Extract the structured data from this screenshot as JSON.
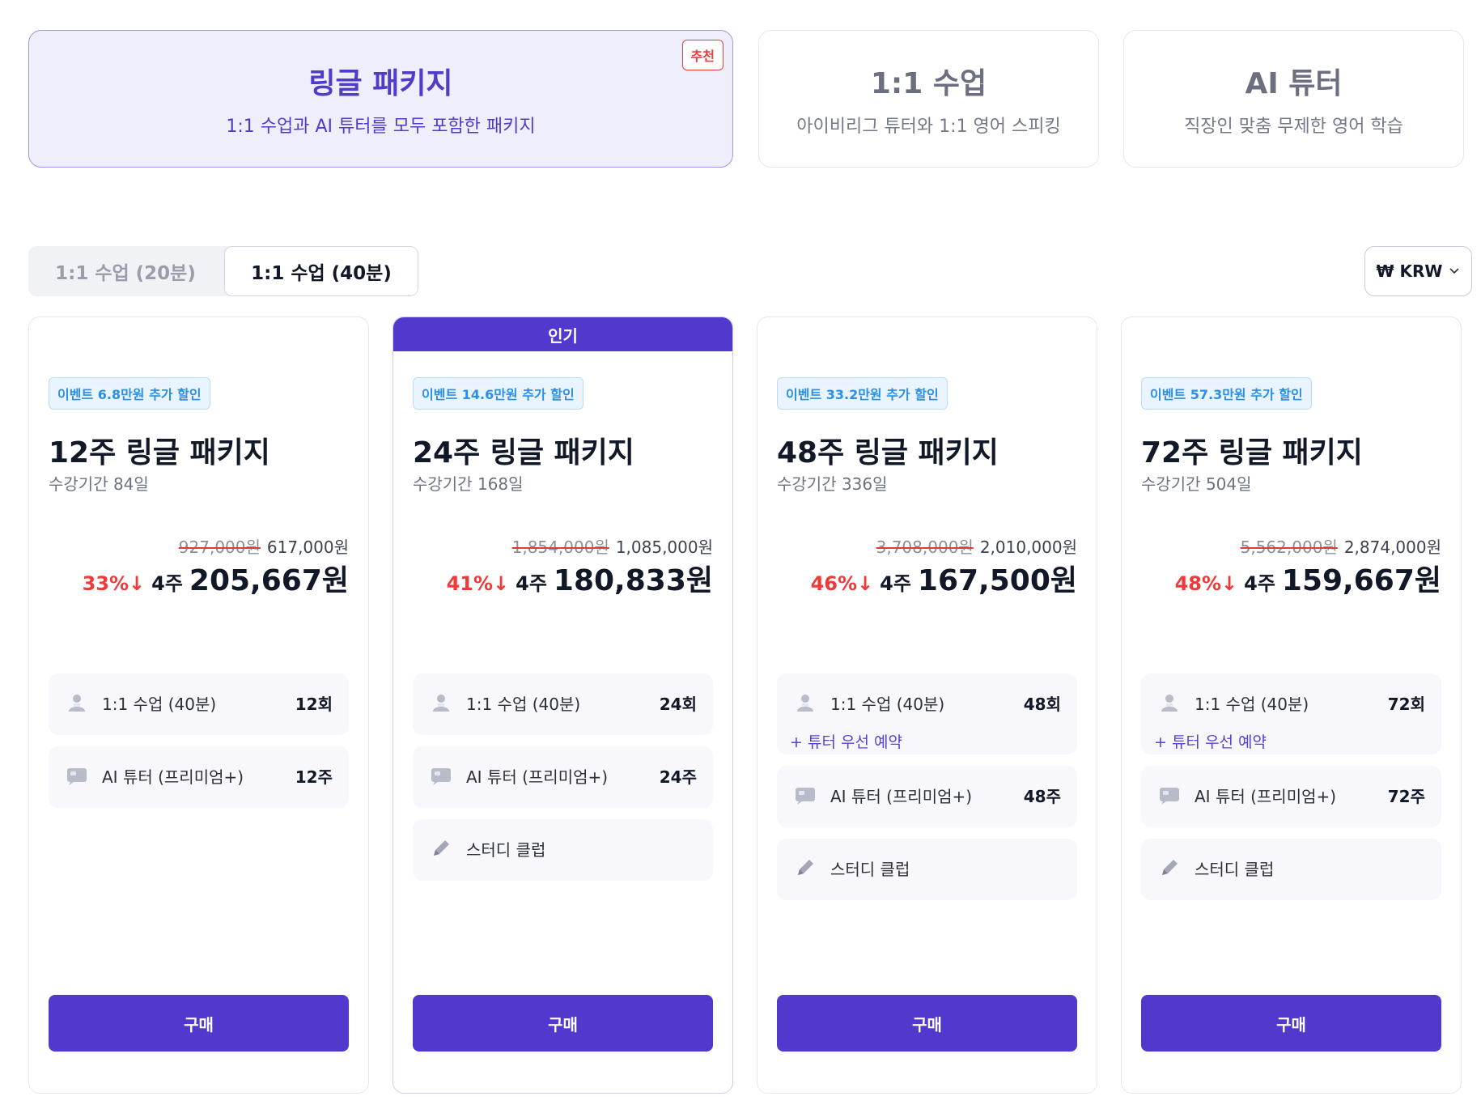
{
  "product_tabs": [
    {
      "title": "링글 패키지",
      "subtitle": "1:1 수업과 AI 튜터를 모두 포함한 패키지",
      "badge": "추천",
      "active": true
    },
    {
      "title": "1:1 수업",
      "subtitle": "아이비리그 튜터와 1:1 영어 스피킹"
    },
    {
      "title": "AI 튜터",
      "subtitle": "직장인 맞춤 무제한 영어 학습"
    }
  ],
  "duration_toggle": {
    "options": [
      "1:1 수업 (20분)",
      "1:1 수업 (40분)"
    ],
    "selected": "1:1 수업 (40분)"
  },
  "currency": {
    "label": "₩ KRW",
    "symbol_icon": "chevron-down-icon"
  },
  "colors": {
    "accent": "#5238cc",
    "discount": "#ef3a3a",
    "event": "#2b8fe6"
  },
  "plans": [
    {
      "event": "이벤트 6.8만원 추가 할인",
      "title": "12주 링글 패키지",
      "period": "수강기간 84일",
      "original_price": "927,000원",
      "price": "617,000원",
      "discount": "33%↓",
      "per_label": "4주",
      "per_price": "205,667원",
      "features": [
        {
          "label": "1:1 수업 (40분)",
          "value": "12회",
          "icon": "tutor-icon"
        },
        {
          "label": "AI 튜터 (프리미엄+)",
          "value": "12주",
          "icon": "chat-icon"
        }
      ],
      "buy": "구매"
    },
    {
      "popular": "인기",
      "event": "이벤트 14.6만원 추가 할인",
      "title": "24주 링글 패키지",
      "period": "수강기간 168일",
      "original_price": "1,854,000원",
      "price": "1,085,000원",
      "discount": "41%↓",
      "per_label": "4주",
      "per_price": "180,833원",
      "features": [
        {
          "label": "1:1 수업 (40분)",
          "value": "24회",
          "icon": "tutor-icon"
        },
        {
          "label": "AI 튜터 (프리미엄+)",
          "value": "24주",
          "icon": "chat-icon"
        },
        {
          "label": "스터디 클럽",
          "value": "",
          "icon": "pencil-icon"
        }
      ],
      "buy": "구매"
    },
    {
      "event": "이벤트 33.2만원 추가 할인",
      "title": "48주 링글 패키지",
      "period": "수강기간 336일",
      "original_price": "3,708,000원",
      "price": "2,010,000원",
      "discount": "46%↓",
      "per_label": "4주",
      "per_price": "167,500원",
      "features": [
        {
          "label": "1:1 수업 (40분)",
          "value": "48회",
          "icon": "tutor-icon",
          "extra": "+ 튜터 우선 예약"
        },
        {
          "label": "AI 튜터 (프리미엄+)",
          "value": "48주",
          "icon": "chat-icon"
        },
        {
          "label": "스터디 클럽",
          "value": "",
          "icon": "pencil-icon"
        }
      ],
      "buy": "구매"
    },
    {
      "event": "이벤트 57.3만원 추가 할인",
      "title": "72주 링글 패키지",
      "period": "수강기간 504일",
      "original_price": "5,562,000원",
      "price": "2,874,000원",
      "discount": "48%↓",
      "per_label": "4주",
      "per_price": "159,667원",
      "features": [
        {
          "label": "1:1 수업 (40분)",
          "value": "72회",
          "icon": "tutor-icon",
          "extra": "+ 튜터 우선 예약"
        },
        {
          "label": "AI 튜터 (프리미엄+)",
          "value": "72주",
          "icon": "chat-icon"
        },
        {
          "label": "스터디 클럽",
          "value": "",
          "icon": "pencil-icon"
        }
      ],
      "buy": "구매"
    }
  ]
}
